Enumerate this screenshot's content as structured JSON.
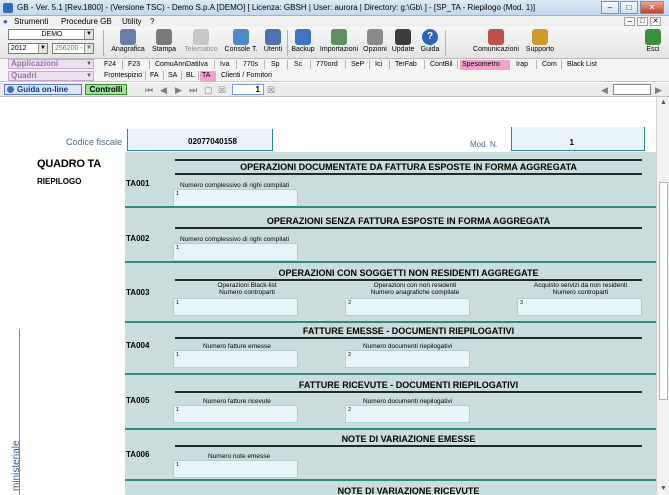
{
  "window": {
    "title": "GB - Ver. 5.1 [Rev.1800] - (Versione TSC) - Demo S.p.A [DEMO]   [ Licenza: GBSH | User: aurora | Directory: g:\\Gb\\ ] - [SP_TA - Riepilogo (Mod. 1)]",
    "minimize": "–",
    "maximize": "□",
    "close": "✕"
  },
  "menu": {
    "items": [
      "Strumenti",
      "Procedure GB",
      "Utility",
      "?"
    ],
    "mini_buttons": [
      "–",
      "□",
      "✕"
    ]
  },
  "toolbar": {
    "company_select": "DEMO",
    "year_select": "2012",
    "code_select": "256200 -",
    "buttons": [
      {
        "label": "Anagrafica",
        "icon": "address-book-icon",
        "color": "#6a7fa6"
      },
      {
        "label": "Stampa",
        "icon": "printer-icon",
        "color": "#7a7a7a"
      },
      {
        "label": "Telematico",
        "icon": "telematic-icon",
        "color": "#b6b6b6"
      },
      {
        "label": "Console T.",
        "icon": "console-icon",
        "color": "#4c8ac8"
      },
      {
        "label": "Utenti",
        "icon": "users-icon",
        "color": "#4f6fb0"
      },
      {
        "label": "Backup",
        "icon": "backup-icon",
        "color": "#3f73c7"
      },
      {
        "label": "Importazioni",
        "icon": "import-icon",
        "color": "#5e8f5e"
      },
      {
        "label": "Opzioni",
        "icon": "options-icon",
        "color": "#8a8a8a"
      },
      {
        "label": "Update",
        "icon": "update-icon",
        "color": "#3d3d3d"
      },
      {
        "label": "Guida",
        "icon": "help-icon",
        "color": "#2f63b8"
      },
      {
        "label": "Comunicazioni",
        "icon": "communications-icon",
        "color": "#c0504d"
      },
      {
        "label": "Supporto",
        "icon": "support-icon",
        "color": "#d09b2c"
      },
      {
        "label": "Esci",
        "icon": "exit-icon",
        "color": "#3b8f3b"
      }
    ]
  },
  "modules": {
    "applicazioni": "Applicazioni",
    "quadri": "Quadri",
    "row2_tabs": [
      "F24",
      "F23",
      "ComuAnnDatiIva",
      "Iva",
      "770s",
      "Sp",
      "Sc",
      "770ord",
      "SeP",
      "Ici",
      "TerFab",
      "ContBil",
      "Spesometro",
      "Irap",
      "Com",
      "Black List"
    ],
    "row2_active": "Spesometro",
    "row3_tabs": [
      "Frontespizio",
      "FA",
      "SA",
      "BL",
      "TA",
      "Clienti / Fornitori"
    ],
    "row3_active": "TA"
  },
  "navbar": {
    "guida": "Guida on-line",
    "controlli": "Controlli",
    "nav_glyphs": [
      "⏮",
      "◀",
      "▶",
      "⏭",
      "▢",
      "☒"
    ],
    "page": "1",
    "page_glyph": "☒"
  },
  "form": {
    "cf_label": "Codice fiscale",
    "cf_value": "02077040158",
    "mod_label": "Mod. N.",
    "mod_value": "1",
    "quadro_title": "QUADRO TA",
    "quadro_subtitle": "RIEPILOGO",
    "side_label": "ministeriale",
    "sections": [
      {
        "code": "TA001",
        "heading": "OPERAZIONI DOCUMENTATE DA FATTURA ESPOSTE IN FORMA AGGREGATA",
        "fields": [
          {
            "label": "Numero complessivo di righi compilati",
            "index": "1"
          }
        ]
      },
      {
        "code": "TA002",
        "heading": "OPERAZIONI SENZA FATTURA ESPOSTE IN FORMA AGGREGATA",
        "fields": [
          {
            "label": "Numero complessivo di righi compilati",
            "index": "1"
          }
        ]
      },
      {
        "code": "TA003",
        "heading": "OPERAZIONI CON SOGGETTI NON RESIDENTI AGGREGATE",
        "fields": [
          {
            "label1": "Operazioni Black-list",
            "label2": "Numero controparti",
            "index": "1"
          },
          {
            "label1": "Operazioni con non residenti",
            "label2": "Numero anagrafiche compilate",
            "index": "2"
          },
          {
            "label1": "Acquisto servizi da non residenti",
            "label2": "Numero controparti",
            "index": "3"
          }
        ]
      },
      {
        "code": "TA004",
        "heading": "FATTURE EMESSE - DOCUMENTI RIEPILOGATIVI",
        "fields": [
          {
            "label": "Numero fatture emesse",
            "index": "1"
          },
          {
            "label": "Numero documenti riepilogativi",
            "index": "2"
          }
        ]
      },
      {
        "code": "TA005",
        "heading": "FATTURE RICEVUTE - DOCUMENTI RIEPILOGATIVI",
        "fields": [
          {
            "label": "Numero fatture ricevute",
            "index": "1"
          },
          {
            "label": "Numero documenti riepilogativi",
            "index": "2"
          }
        ]
      },
      {
        "code": "TA006",
        "heading": "NOTE DI VARIAZIONE EMESSE",
        "fields": [
          {
            "label": "Numero note emesse",
            "index": "1"
          }
        ]
      },
      {
        "code": "",
        "heading": "NOTE DI VARIAZIONE RICEVUTE",
        "fields": []
      }
    ]
  },
  "colors": {
    "panel": "#cbdcdc",
    "field": "#e9f4f8",
    "accent_teal": "#2f8b7f",
    "tab_active": "#f5a0d0"
  }
}
